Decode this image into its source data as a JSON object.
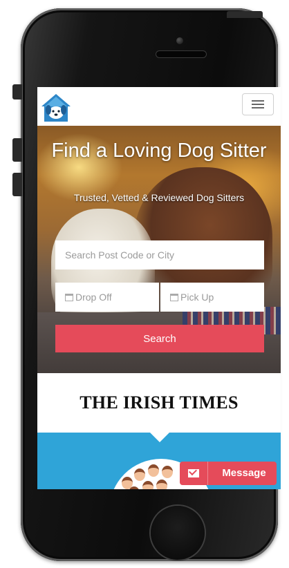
{
  "brand": {
    "logo_icon": "dog-house-logo",
    "accent_color": "#e54b5a",
    "secondary_color": "#2fa4d8"
  },
  "navbar": {
    "menu_icon": "hamburger-icon"
  },
  "hero": {
    "title": "Find a Loving Dog Sitter",
    "subtitle": "Trusted, Vetted & Reviewed Dog Sitters",
    "search_placeholder": "Search Post Code or City",
    "drop_off_label": "Drop Off",
    "pick_up_label": "Pick Up",
    "calendar_icon": "calendar-icon",
    "search_button_label": "Search"
  },
  "press": {
    "logo_text": "THE IRISH TIMES"
  },
  "message": {
    "label": "Message",
    "icon": "envelope-icon"
  }
}
